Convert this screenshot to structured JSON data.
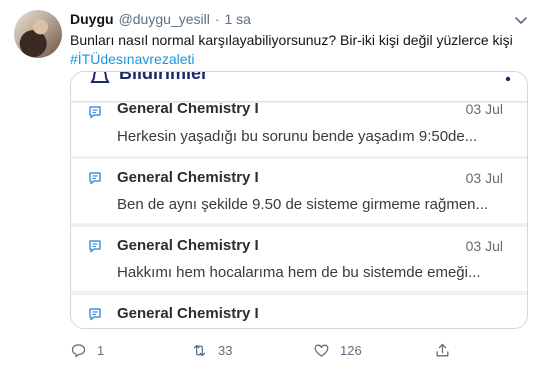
{
  "tweet": {
    "author_name": "Duygu",
    "author_handle": "@duygu_yesill",
    "separator": "·",
    "time": "1 sa",
    "text": "Bunları nasıl normal karşılayabiliyorsunuz? Bir-iki kişi değil yüzlerce kişi",
    "hashtag": "#İTÜdesınavrezaleti"
  },
  "media": {
    "app_title": "Bildirimler",
    "notifications": [
      {
        "course": "General Chemistry I",
        "date": "03 Jul",
        "preview": "Herkesin yaşadığı bu  sorunu bende yaşadım 9:50de..."
      },
      {
        "course": "General Chemistry I",
        "date": "03 Jul",
        "preview": "Ben de aynı şekilde 9.50 de sisteme girmeme rağmen..."
      },
      {
        "course": "General Chemistry I",
        "date": "03 Jul",
        "preview": "Hakkımı hem hocalarıma hem de bu sistemde emeği..."
      },
      {
        "course": "General Chemistry I",
        "date": "",
        "preview": ""
      }
    ]
  },
  "actions": {
    "reply_count": "1",
    "retweet_count": "33",
    "like_count": "126"
  },
  "icons": {
    "reply": "reply-icon",
    "retweet": "retweet-icon",
    "like": "heart-icon",
    "share": "share-icon",
    "more": "chevron-down-icon"
  },
  "colors": {
    "hashtag": "#1b95e0",
    "secondary_text": "#5b7083",
    "app_accent": "#1a2a6c",
    "doc_icon": "#4a90e2"
  }
}
